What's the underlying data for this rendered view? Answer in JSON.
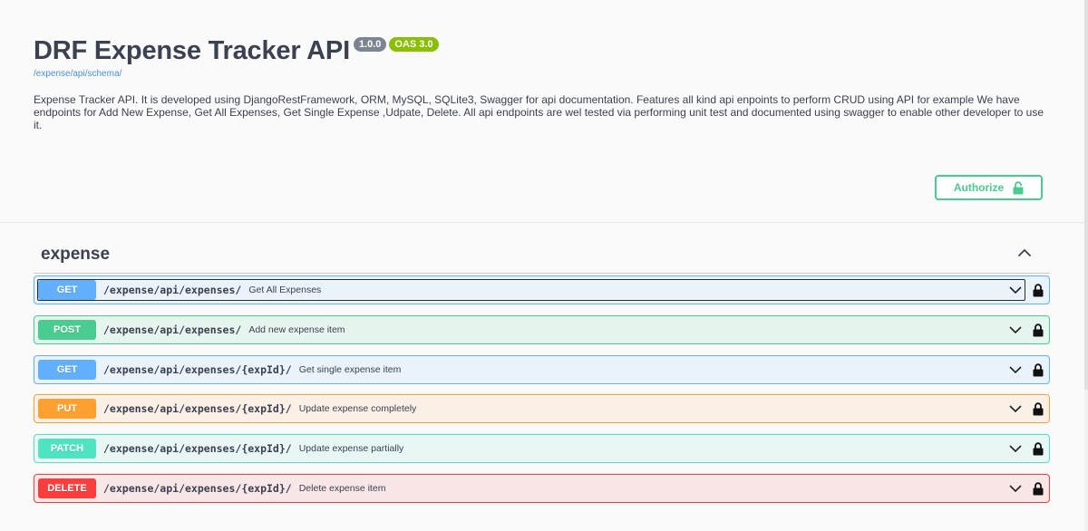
{
  "info": {
    "title": "DRF Expense Tracker API",
    "version_badge": "1.0.0",
    "oas_badge": "OAS 3.0",
    "schema_link": "/expense/api/schema/",
    "description": "Expense Tracker API. It is developed using DjangoRestFramework, ORM, MySQL, SQLite3, Swagger for api documentation. Features all kind api enpoints to perform CRUD using API for example We have endpoints for Add New Expense, Get All Expenses, Get Single Expense ,Udpate, Delete. All api endpoints are wel tested via performing unit test and documented using swagger to enable other developer to use it."
  },
  "authorize": {
    "label": "Authorize",
    "icon": "unlocked-padlock-icon"
  },
  "tag": {
    "name": "expense",
    "expanded": true,
    "icon": "chevron-up-icon"
  },
  "colors": {
    "get": "#61affe",
    "post": "#49cc90",
    "put": "#fca130",
    "patch": "#50e3c2",
    "delete": "#f93e3e",
    "authorize": "#49cc90"
  },
  "operations": [
    {
      "method": "GET",
      "path": "/expense/api/expenses/",
      "summary": "Get All Expenses",
      "focused": true
    },
    {
      "method": "POST",
      "path": "/expense/api/expenses/",
      "summary": "Add new expense item"
    },
    {
      "method": "GET",
      "path": "/expense/api/expenses/{expId}/",
      "summary": "Get single expense item"
    },
    {
      "method": "PUT",
      "path": "/expense/api/expenses/{expId}/",
      "summary": "Update expense completely"
    },
    {
      "method": "PATCH",
      "path": "/expense/api/expenses/{expId}/",
      "summary": "Update expense partially"
    },
    {
      "method": "DELETE",
      "path": "/expense/api/expenses/{expId}/",
      "summary": "Delete expense item"
    }
  ]
}
